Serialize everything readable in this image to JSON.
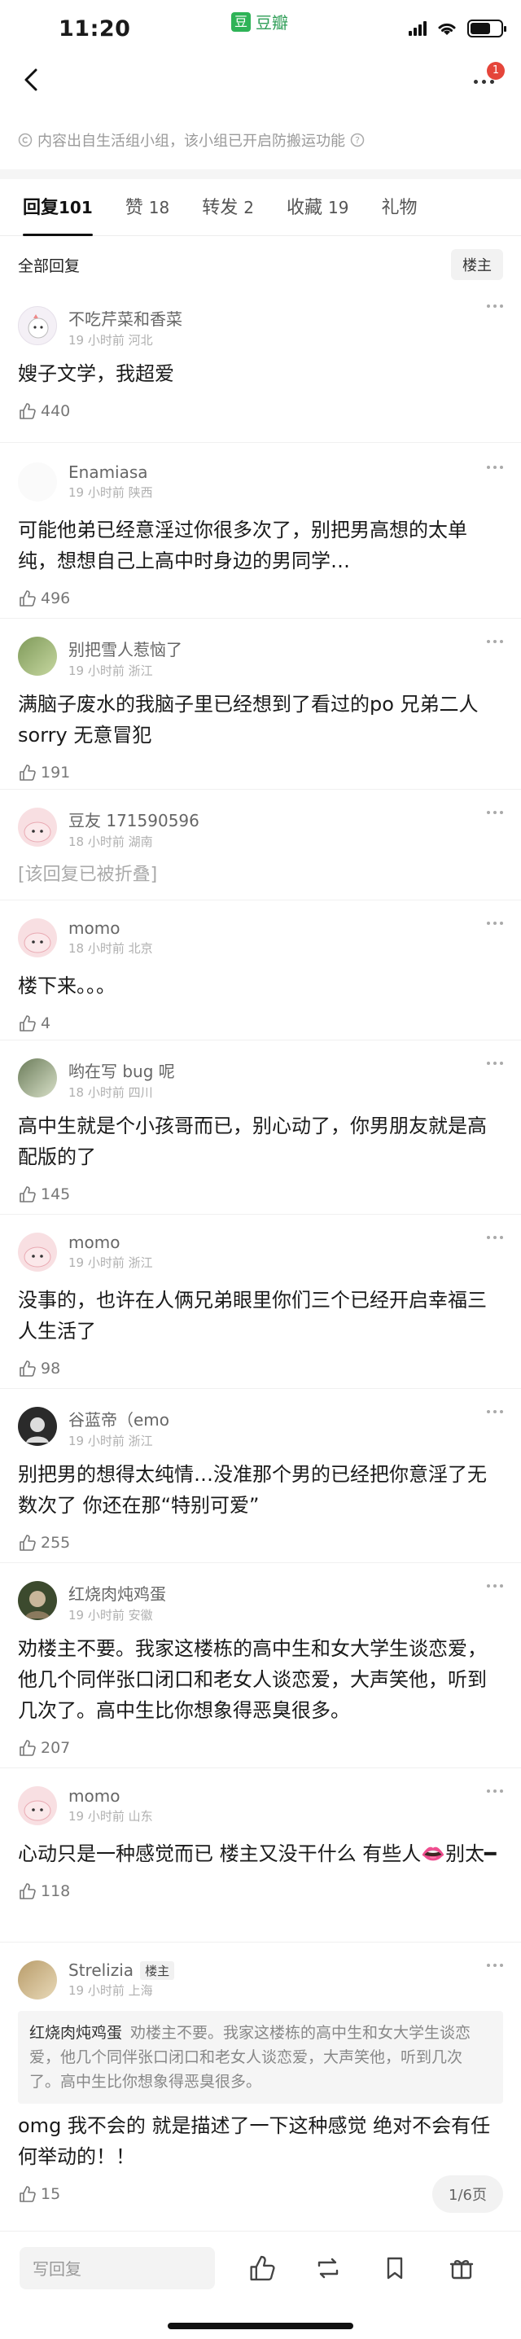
{
  "status": {
    "time": "11:20",
    "app": "豆瓣"
  },
  "nav": {
    "badge": "1"
  },
  "notice": "内容出自生活组小组，该小组已开启防搬运功能",
  "tabs": [
    {
      "label": "回复",
      "count": "101"
    },
    {
      "label": "赞",
      "count": "18"
    },
    {
      "label": "转发",
      "count": "2"
    },
    {
      "label": "收藏",
      "count": "19"
    },
    {
      "label": "礼物",
      "count": ""
    }
  ],
  "filter": {
    "label": "全部回复",
    "op_button": "楼主"
  },
  "comments": [
    {
      "name": "不吃芹菜和香菜",
      "time": "19 小时前",
      "loc": "河北",
      "text": "嫂子文学，我超爱",
      "likes": "440"
    },
    {
      "name": "Enamiasa",
      "time": "19 小时前",
      "loc": "陕西",
      "text": "可能他弟已经意淫过你很多次了，别把男高想的太单纯，想想自己上高中时身边的男同学…",
      "likes": "496"
    },
    {
      "name": "别把雪人惹恼了",
      "time": "19 小时前",
      "loc": "浙江",
      "text": "满脑子废水的我脑子里已经想到了看过的po 兄弟二人 sorry 无意冒犯",
      "likes": "191"
    },
    {
      "name": "豆友 171590596",
      "time": "18 小时前",
      "loc": "湖南",
      "text": "[该回复已被折叠]",
      "likes": ""
    },
    {
      "name": "momo",
      "time": "18 小时前",
      "loc": "北京",
      "text": "楼下来。。。",
      "likes": "4"
    },
    {
      "name": "哟在写 bug 呢",
      "time": "18 小时前",
      "loc": "四川",
      "text": "高中生就是个小孩哥而已，别心动了，你男朋友就是高配版的了",
      "likes": "145"
    },
    {
      "name": "momo",
      "time": "19 小时前",
      "loc": "浙江",
      "text": "没事的，也许在人俩兄弟眼里你们三个已经开启幸福三人生活了",
      "likes": "98"
    },
    {
      "name": "谷蓝帝（emo",
      "time": "19 小时前",
      "loc": "浙江",
      "text": "别把男的想得太纯情…没准那个男的已经把你意淫了无数次了 你还在那“特别可爱”",
      "likes": "255"
    },
    {
      "name": "红烧肉炖鸡蛋",
      "time": "19 小时前",
      "loc": "安徽",
      "text": "劝楼主不要。我家这楼栋的高中生和女大学生谈恋爱，他几个同伴张口闭口和老女人谈恋爱，大声笑他，听到几次了。高中生比你想象得恶臭很多。",
      "likes": "207"
    },
    {
      "name": "momo",
      "time": "19 小时前",
      "loc": "山东",
      "text": "心动只是一种感觉而已 楼主又没干什么 有些人👄别太━",
      "likes": "118"
    },
    {
      "name": "Strelizia",
      "op_tag": "楼主",
      "time": "19 小时前",
      "loc": "上海",
      "quote_name": "红烧肉炖鸡蛋",
      "quote_text": "劝楼主不要。我家这楼栋的高中生和女大学生谈恋爱，他几个同伴张口闭口和老女人谈恋爱，大声笑他，听到几次了。高中生比你想象得恶臭很多。",
      "text": "omg 我不会的 就是描述了一下这种感觉 绝对不会有任何举动的！！",
      "likes": "15"
    }
  ],
  "pager": "1/6页",
  "bottom": {
    "reply_placeholder": "写回复"
  }
}
